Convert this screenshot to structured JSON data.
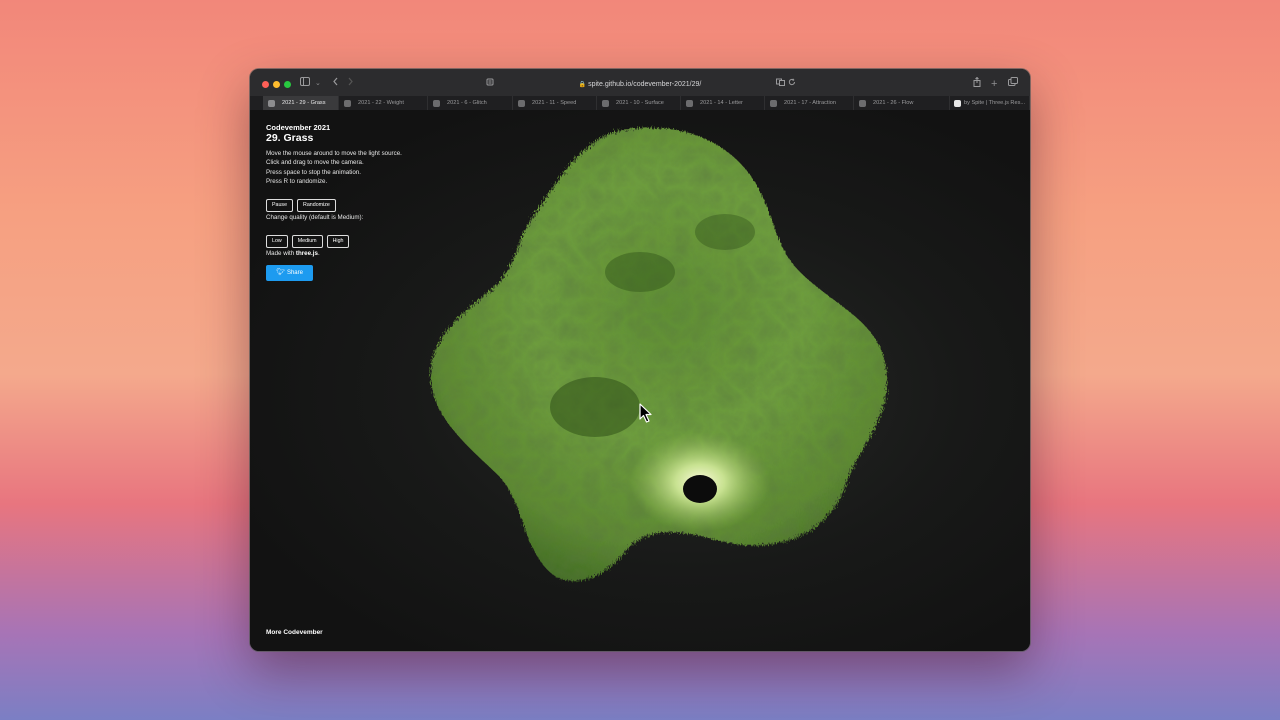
{
  "browser": {
    "url": "spite.github.io/codevember-2021/29/",
    "tabs": [
      {
        "label": "2021 - 29 - Grass",
        "active": true
      },
      {
        "label": "2021 - 22 - Weight",
        "active": false
      },
      {
        "label": "2021 - 6 - Glitch",
        "active": false
      },
      {
        "label": "2021 - 11 - Speed",
        "active": false
      },
      {
        "label": "2021 - 10 - Surface",
        "active": false
      },
      {
        "label": "2021 - 14 - Letter",
        "active": false
      },
      {
        "label": "2021 - 17 - Attraction",
        "active": false
      },
      {
        "label": "2021 - 26 - Flow",
        "active": false
      },
      {
        "label": "by Spite | Three.js Res...",
        "active": false
      }
    ]
  },
  "page": {
    "eyebrow": "Codevember 2021",
    "title": "29. Grass",
    "instructions": [
      "Move the mouse around to move the light source.",
      "Click and drag to move the camera.",
      "Press space to stop the animation.",
      "Press R to randomize."
    ],
    "pause_label": "Pause",
    "randomize_label": "Randomize",
    "quality_label": "Change quality (default is Medium):",
    "quality_options": [
      "Low",
      "Medium",
      "High"
    ],
    "made_with_prefix": "Made with ",
    "made_with_link": "three.js",
    "made_with_suffix": ".",
    "share_label": "Share",
    "more_label": "More Codevember"
  },
  "colors": {
    "grass_light": "#7fb04a",
    "grass_dark": "#3f6a22",
    "share_blue": "#1d9bf0"
  }
}
